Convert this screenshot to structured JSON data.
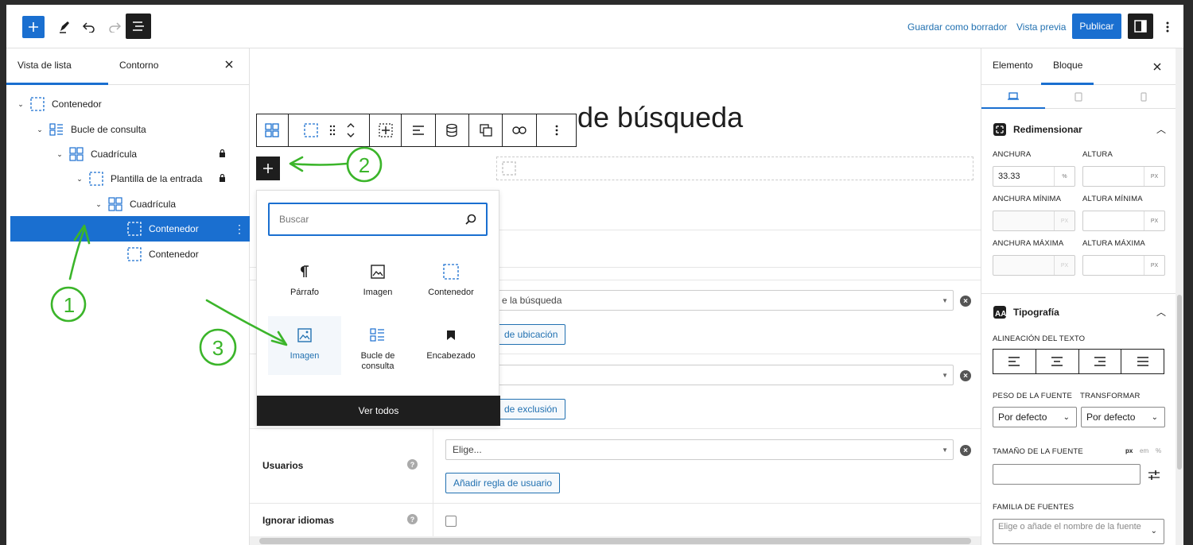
{
  "topbar": {
    "save_draft": "Guardar como borrador",
    "preview": "Vista previa",
    "publish": "Publicar"
  },
  "left_panel": {
    "tab_list": "Vista de lista",
    "tab_outline": "Contorno",
    "tree": [
      {
        "label": "Contenedor",
        "icon": "container-icon",
        "locked": false
      },
      {
        "label": "Bucle de consulta",
        "icon": "query-loop-icon",
        "locked": false
      },
      {
        "label": "Cuadrícula",
        "icon": "grid-icon",
        "locked": true
      },
      {
        "label": "Plantilla de la entrada",
        "icon": "container-icon",
        "locked": true
      },
      {
        "label": "Cuadrícula",
        "icon": "grid-icon",
        "locked": false
      },
      {
        "label": "Contenedor",
        "icon": "container-icon",
        "locked": false,
        "selected": true
      },
      {
        "label": "Contenedor",
        "icon": "container-icon",
        "locked": false
      }
    ]
  },
  "canvas": {
    "title_visible": "de búsqueda",
    "inserter": {
      "search_placeholder": "Buscar",
      "items": [
        {
          "label": "Párrafo",
          "icon": "paragraph-icon"
        },
        {
          "label": "Imagen",
          "icon": "image-icon"
        },
        {
          "label": "Contenedor",
          "icon": "container-icon"
        },
        {
          "label": "Imagen",
          "icon": "image-icon",
          "highlighted": true
        },
        {
          "label": "Bucle de consulta",
          "icon": "query-loop-icon"
        },
        {
          "label": "Encabezado",
          "icon": "bookmark-icon"
        }
      ],
      "view_all": "Ver todos"
    },
    "form": {
      "row1_select": "e la búsqueda",
      "row1_button": "de ubicación",
      "row2_button": "de exclusión",
      "users_label": "Usuarios",
      "users_select": "Elige...",
      "users_button": "Añadir regla de usuario",
      "ignore_lang_label": "Ignorar idiomas"
    },
    "annotations": {
      "one": "1",
      "two": "2",
      "three": "3"
    },
    "annotation_color": "#3bb52a"
  },
  "right_panel": {
    "tab_element": "Elemento",
    "tab_block": "Bloque",
    "resize_title": "Redimensionar",
    "width_label": "ANCHURA",
    "width_value": "33.33",
    "width_unit": "%",
    "height_label": "ALTURA",
    "min_width_label": "ANCHURA MÍNIMA",
    "min_height_label": "ALTURA MÍNIMA",
    "max_width_label": "ANCHURA MÁXIMA",
    "max_height_label": "ALTURA MÁXIMA",
    "px_unit": "PX",
    "typography_title": "Tipografía",
    "text_align_label": "ALINEACIÓN DEL TEXTO",
    "font_weight_label": "PESO DE LA FUENTE",
    "transform_label": "TRANSFORMAR",
    "font_weight_value": "Por defecto",
    "transform_value": "Por defecto",
    "font_size_label": "TAMAÑO DE LA FUENTE",
    "size_units": [
      "px",
      "em",
      "%"
    ],
    "font_family_label": "FAMILIA DE FUENTES",
    "font_family_placeholder": "Elige o añade el nombre de la fuente"
  },
  "colors": {
    "accent": "#1a6fd0",
    "dark": "#1e1e1e"
  }
}
